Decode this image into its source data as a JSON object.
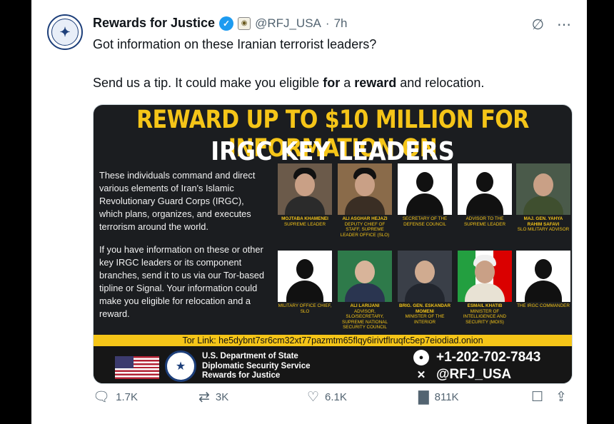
{
  "tweet": {
    "author_name": "Rewards for Justice",
    "handle": "@RFJ_USA",
    "separator": "·",
    "time": "7h",
    "line1": "Got information on these Iranian terrorist leaders?",
    "line2_a": "Send us a tip. It could make you eligible ",
    "line2_b": "for",
    "line2_c": " a ",
    "line2_d": "reward",
    "line2_e": " and relocation."
  },
  "icons": {
    "verified": "verified-icon",
    "gov_badge": "government-badge-icon",
    "grok": "grok-icon",
    "more": "more-icon",
    "reply": "reply-icon",
    "retweet": "retweet-icon",
    "like": "like-icon",
    "views": "views-icon",
    "bookmark": "bookmark-icon",
    "share": "share-icon"
  },
  "poster": {
    "title1": "REWARD UP TO $10 MILLION FOR INFORMATION ON",
    "title2": "IRGC KEY LEADERS",
    "desc1": "These individuals command and direct various elements of Iran's Islamic Revolutionary Guard Corps (IRGC), which plans, organizes, and executes terrorism around the world.",
    "desc2": "If you have information on these or other key IRGC leaders or its component branches, send it to us via our Tor-based tipline or Signal. Your information could make you eligible for relocation and a reward.",
    "people": [
      {
        "name": "MOJTABA KHAMENEI",
        "title": "SUPREME LEADER"
      },
      {
        "name": "ALI ASGHAR HEJAZI",
        "title": "DEPUTY CHIEF OF STAFF, SUPREME LEADER OFFICE (SLO)"
      },
      {
        "name": "",
        "title": "SECRETARY OF THE DEFENSE COUNCIL"
      },
      {
        "name": "",
        "title": "ADVISOR TO THE SUPREME LEADER"
      },
      {
        "name": "MAJ. GEN. YAHYA RAHIM SAFAVI",
        "title": "SLO MILITARY ADVISOR"
      },
      {
        "name": "",
        "title": "MILITARY OFFICE CHIEF, SLO"
      },
      {
        "name": "ALI LARIJANI",
        "title": "ADVISOR, SLO/SECRETARY, SUPREME NATIONAL SECURITY COUNCIL"
      },
      {
        "name": "BRIG. GEN. ESKANDAR MOMENI",
        "title": "MINISTER OF THE INTERIOR"
      },
      {
        "name": "ESMAIL KHATIB",
        "title": "MINISTER OF INTELLIGENCE AND SECURITY (MOIS)"
      },
      {
        "name": "",
        "title": "THE IRGC COMMANDER"
      }
    ],
    "tor": "Tor Link: he5dybnt7sr6cm32xt77pazmtm65flqy6irivtflruqfc5ep7eiodiad.onion",
    "dept1": "U.S. Department of State",
    "dept2": "Diplomatic Security Service",
    "dept3": "Rewards for Justice",
    "phone": "+1-202-702-7843",
    "x_handle": "@RFJ_USA"
  },
  "stats": {
    "replies": "1.7K",
    "retweets": "3K",
    "likes": "6.1K",
    "views": "811K"
  }
}
